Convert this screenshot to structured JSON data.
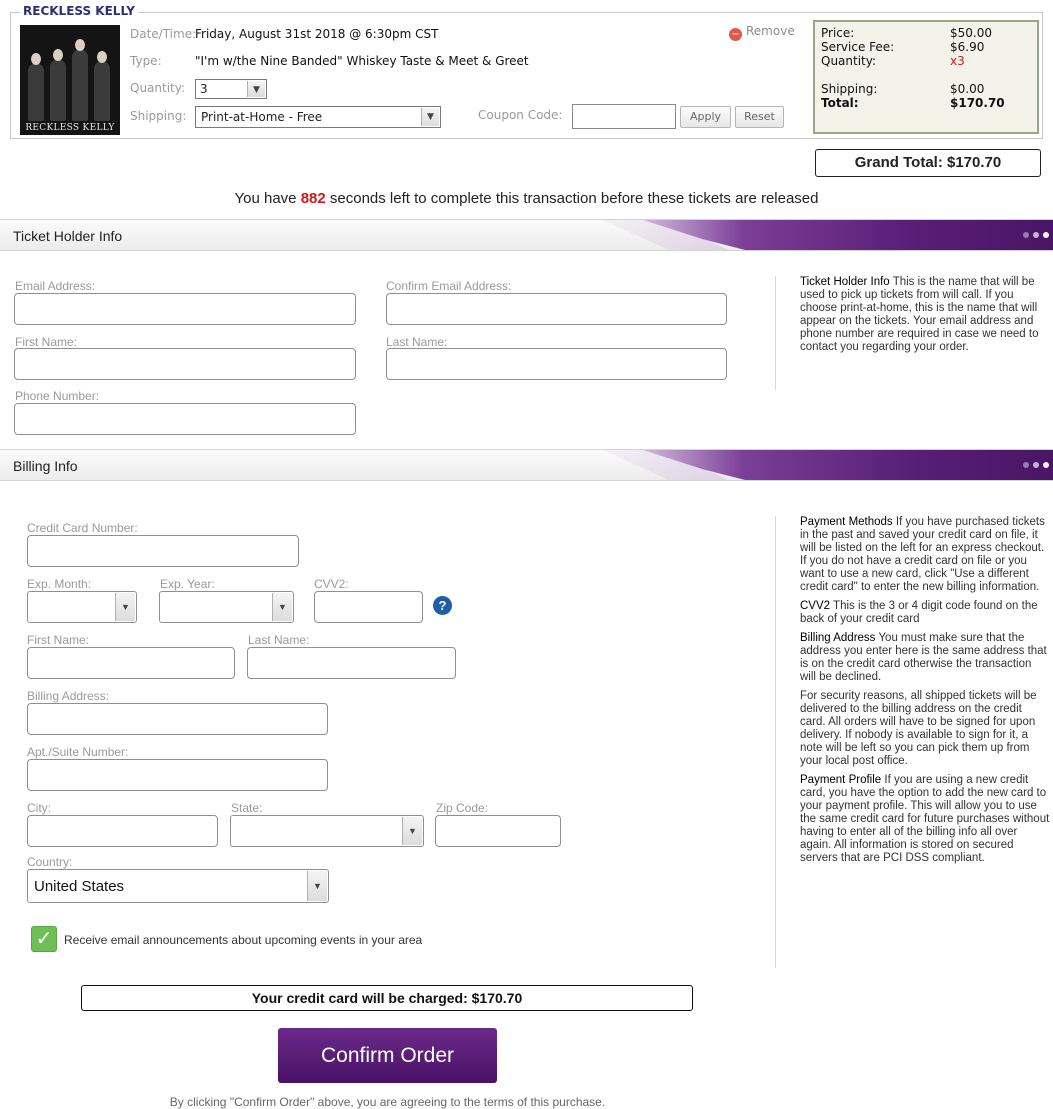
{
  "order": {
    "legend": "RECKLESS KELLY",
    "photo_caption": "RECKLESS KELLY",
    "datetime_label": "Date/Time:",
    "datetime_value": "Friday, August 31st 2018 @ 6:30pm CST",
    "type_label": "Type:",
    "type_value": "\"I'm w/the Nine Banded\" Whiskey Taste & Meet & Greet",
    "quantity_label": "Quantity:",
    "quantity_value": "3",
    "shipping_label": "Shipping:",
    "shipping_value": "Print-at-Home - Free",
    "coupon_label": "Coupon Code:",
    "coupon_value": "",
    "apply_label": "Apply",
    "reset_label": "Reset",
    "remove_label": "Remove"
  },
  "pricing": {
    "price_label": "Price:",
    "price_value": "$50.00",
    "fee_label": "Service Fee:",
    "fee_value": "$6.90",
    "qty_label": "Quantity:",
    "qty_value": "x3",
    "shipping_label": "Shipping:",
    "shipping_value": "$0.00",
    "total_label": "Total:",
    "total_value": "$170.70"
  },
  "grand_total": "Grand Total: $170.70",
  "timer": {
    "prefix": "You have",
    "seconds": "882",
    "suffix": "seconds left to complete this transaction before these tickets are released"
  },
  "ticket_holder": {
    "header": "Ticket Holder Info",
    "email_label": "Email Address:",
    "confirm_email_label": "Confirm Email Address:",
    "first_name_label": "First Name:",
    "last_name_label": "Last Name:",
    "phone_label": "Phone Number:",
    "help_title": "Ticket Holder Info",
    "help_text": "This is the name that will be used to pick up tickets from will call. If you choose print-at-home, this is the name that will appear on the tickets. Your email address and phone number are required in case we need to contact you regarding your order."
  },
  "billing": {
    "header": "Billing Info",
    "card_number_label": "Credit Card Number:",
    "exp_month_label": "Exp. Month:",
    "exp_year_label": "Exp. Year:",
    "cvv_label": "CVV2:",
    "first_name_label": "First Name:",
    "last_name_label": "Last Name:",
    "address_label": "Billing Address:",
    "apt_label": "Apt./Suite Number:",
    "city_label": "City:",
    "state_label": "State:",
    "zip_label": "Zip Code:",
    "country_label": "Country:",
    "country_value": "United States",
    "email_opt_label": "Receive email announcements about upcoming events in your area",
    "help": {
      "payment_methods_title": "Payment Methods",
      "payment_methods_text": "If you have purchased tickets in the past and saved your credit card on file, it will be listed on the left for an express checkout. If you do not have a credit card on file or you want to use a new card, click \"Use a different credit card\" to enter the new billing information.",
      "cvv_title": "CVV2",
      "cvv_text": "This is the 3 or 4 digit code found on the back of your credit card",
      "billing_address_title": "Billing Address",
      "billing_address_text": "You must make sure that the address you enter here is the same address that is on the credit card otherwise the transaction will be declined.",
      "security_text": "For security reasons, all shipped tickets will be delivered to the billing address on the credit card. All orders will have to be signed for upon delivery. If nobody is available to sign for it, a note will be left so you can pick them up from your local post office.",
      "payment_profile_title": "Payment Profile",
      "payment_profile_text": "If you are using a new credit card, you have the option to add the new card to your payment profile. This will allow you to use the same credit card for future purchases without having to enter all of the billing info all over again. All information is stored on secured servers that are PCI DSS compliant."
    }
  },
  "charge_text": "Your credit card will be charged: $170.70",
  "confirm_label": "Confirm Order",
  "terms_text": "By clicking \"Confirm Order\" above, you are agreeing to the terms of this purchase.",
  "colors": {
    "brand_purple": "#5a1f78",
    "timer_red": "#d11a1a",
    "check_green": "#6fbf56",
    "help_blue": "#1f5fa8"
  }
}
